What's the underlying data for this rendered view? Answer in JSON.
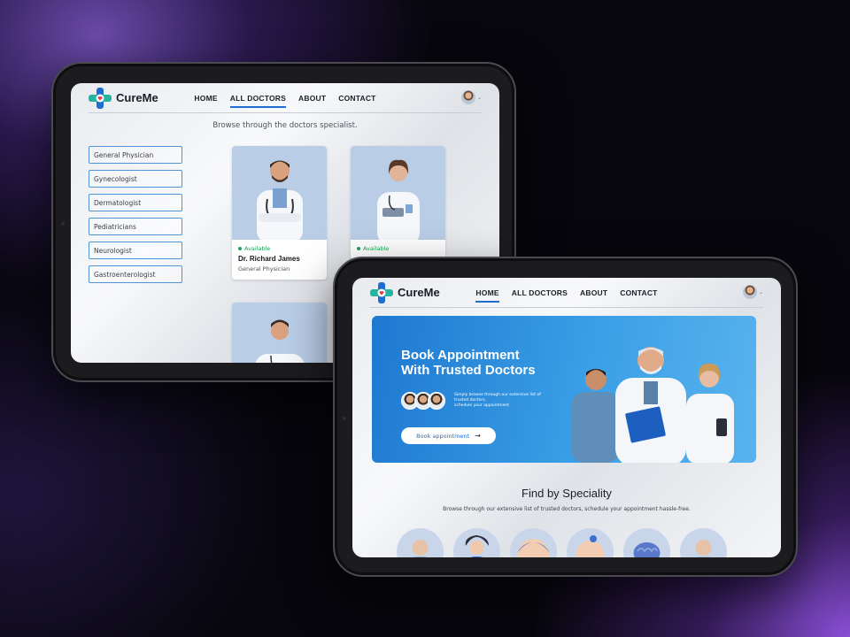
{
  "brand": {
    "name": "CureMe"
  },
  "nav": {
    "home": "HOME",
    "all_doctors": "ALL DOCTORS",
    "about": "ABOUT",
    "contact": "CONTACT"
  },
  "doctors_page": {
    "heading": "Browse through the doctors specialist.",
    "specialities": [
      "General Physician",
      "Gynecologist",
      "Dermatologist",
      "Pediatricians",
      "Neurologist",
      "Gastroenterologist"
    ],
    "cards": [
      {
        "status": "Available",
        "name": "Dr. Richard James",
        "speciality": "General Physician"
      },
      {
        "status": "Available"
      },
      {}
    ]
  },
  "home_page": {
    "hero": {
      "title_line1": "Book Appointment",
      "title_line2": "With Trusted Doctors",
      "sub_line1": "Simply browse through our extensive list of",
      "sub_line2": "trusted doctors,",
      "sub_line3": "schedule your appointment",
      "button": "Book appointment",
      "button_arrow": "→"
    },
    "speciality": {
      "title": "Find by Speciality",
      "subtitle": "Browse through our extensive list of trusted doctors, schedule your appointment hassle-free."
    }
  },
  "icons": {
    "chevron": "⌄"
  },
  "colors": {
    "accent": "#1e6ed1",
    "available": "#21a35b",
    "hero": "#2b8de0"
  }
}
